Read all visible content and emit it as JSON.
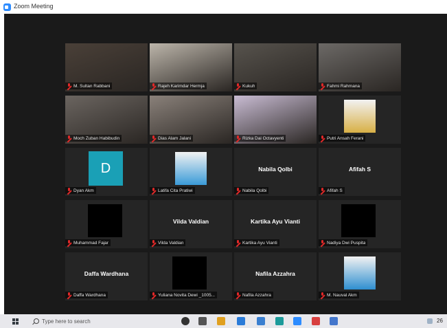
{
  "window": {
    "title": "Zoom Meeting"
  },
  "tiles": [
    {
      "name": "M. Sultan Rabbani",
      "display": "",
      "type": "video",
      "bg": "#4a4038"
    },
    {
      "name": "Rajeh Karimdar Hermja",
      "display": "",
      "type": "video",
      "active": true,
      "bg": "#bcb5aa"
    },
    {
      "name": "Kukuh",
      "display": "",
      "type": "video",
      "bg": "#57534d"
    },
    {
      "name": "Fahmi Rahmana",
      "display": "",
      "type": "video",
      "bg": "#6c6966"
    },
    {
      "name": "Moch Zuban Habibudin",
      "display": "",
      "type": "video",
      "bg": "#6b6560"
    },
    {
      "name": "Dias Alam Jalani",
      "display": "",
      "type": "video",
      "bg": "#8a817a"
    },
    {
      "name": "Rizka Dai Octavyenti",
      "display": "",
      "type": "video",
      "bg": "#c9bcd3"
    },
    {
      "name": "Putri Ansah Ferani",
      "display": "",
      "type": "avatar-img",
      "bg": "#d8b046"
    },
    {
      "name": "Dyan Akm",
      "display": "D",
      "type": "letter"
    },
    {
      "name": "Latifa Cita Pratiwi",
      "display": "",
      "type": "avatar-img",
      "bg": "#3a9bd8"
    },
    {
      "name": "Nabila Qolbi",
      "display": "Nabila Qolbi",
      "type": "text"
    },
    {
      "name": "Afifah S",
      "display": "Afifah S",
      "type": "text"
    },
    {
      "name": "Muhammad Fajar",
      "display": "",
      "type": "black"
    },
    {
      "name": "Vilda Valdian",
      "display": "Vilda Valdian",
      "type": "text"
    },
    {
      "name": "Kartika Ayu Vianti",
      "display": "Kartika Ayu Vianti",
      "type": "text"
    },
    {
      "name": "Nadiya Dwi Puspita",
      "display": "",
      "type": "black"
    },
    {
      "name": "Daffa Wardhana",
      "display": "Daffa Wardhana",
      "type": "text"
    },
    {
      "name": "Yuliana Novita Dewi _1005...",
      "display": "",
      "type": "black"
    },
    {
      "name": "Nafila Azzahra",
      "display": "Nafila Azzahra",
      "type": "text"
    },
    {
      "name": "M. Nauval Akm",
      "display": "",
      "type": "avatar-img",
      "bg": "#2f8fd0"
    }
  ],
  "taskbar": {
    "search_placeholder": "Type here to search",
    "clock": "26",
    "icons": [
      "task-view-icon",
      "file-explorer-icon",
      "windows-store-icon",
      "chrome-icon",
      "mail-icon",
      "photos-icon",
      "zoom-icon",
      "notepad-icon",
      "settings-icon"
    ]
  }
}
